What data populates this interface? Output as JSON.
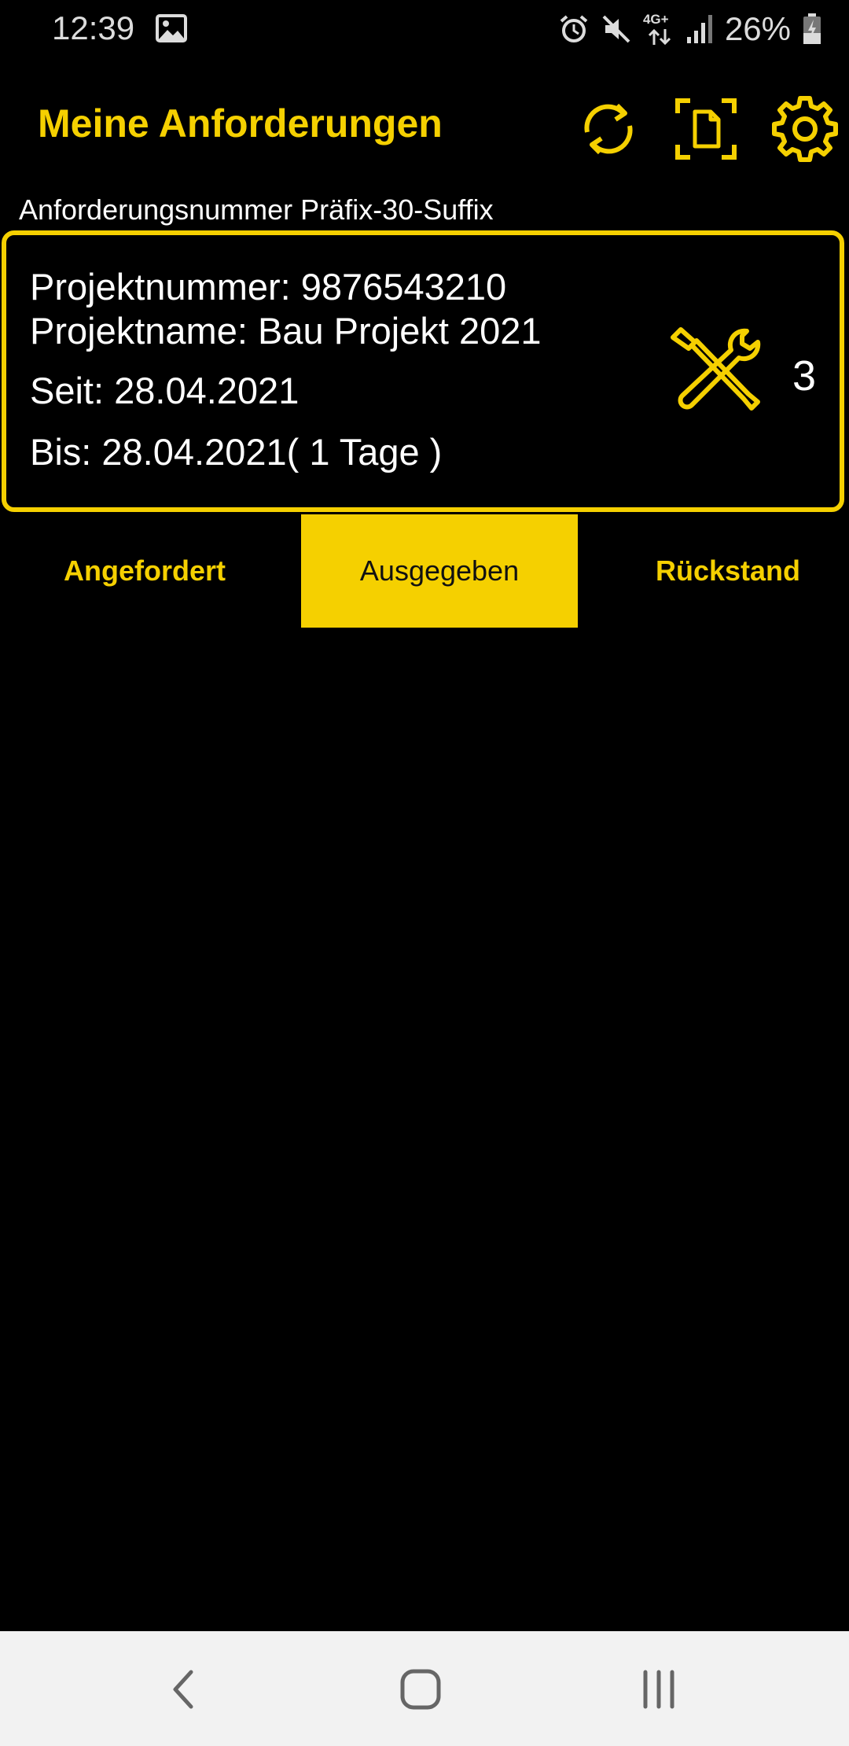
{
  "status_bar": {
    "time": "12:39",
    "network": "4G+",
    "battery": "26%",
    "icons": [
      "gallery-icon",
      "alarm-icon",
      "mute-icon",
      "network-data-icon",
      "signal-icon",
      "battery-icon"
    ]
  },
  "header": {
    "title": "Meine Anforderungen",
    "icons": [
      "refresh-icon",
      "scan-document-icon",
      "settings-icon"
    ]
  },
  "request": {
    "number_label": "Anforderungsnummer Präfix-30-Suffix"
  },
  "card": {
    "project_number": "Projektnummer: 9876543210",
    "project_name": "Projektname: Bau Projekt 2021",
    "since": "Seit: 28.04.2021",
    "until": "Bis: 28.04.2021( 1 Tage )",
    "count": "3",
    "icon": "tools-icon"
  },
  "tabs": [
    {
      "label": "Angefordert",
      "active": false
    },
    {
      "label": "Ausgegeben",
      "active": true
    },
    {
      "label": "Rückstand",
      "active": false
    }
  ],
  "colors": {
    "accent": "#F5D000",
    "background": "#000000",
    "navbar": "#F2F2F2"
  },
  "navbar": {
    "icons": [
      "back-icon",
      "home-icon",
      "recent-apps-icon"
    ]
  }
}
